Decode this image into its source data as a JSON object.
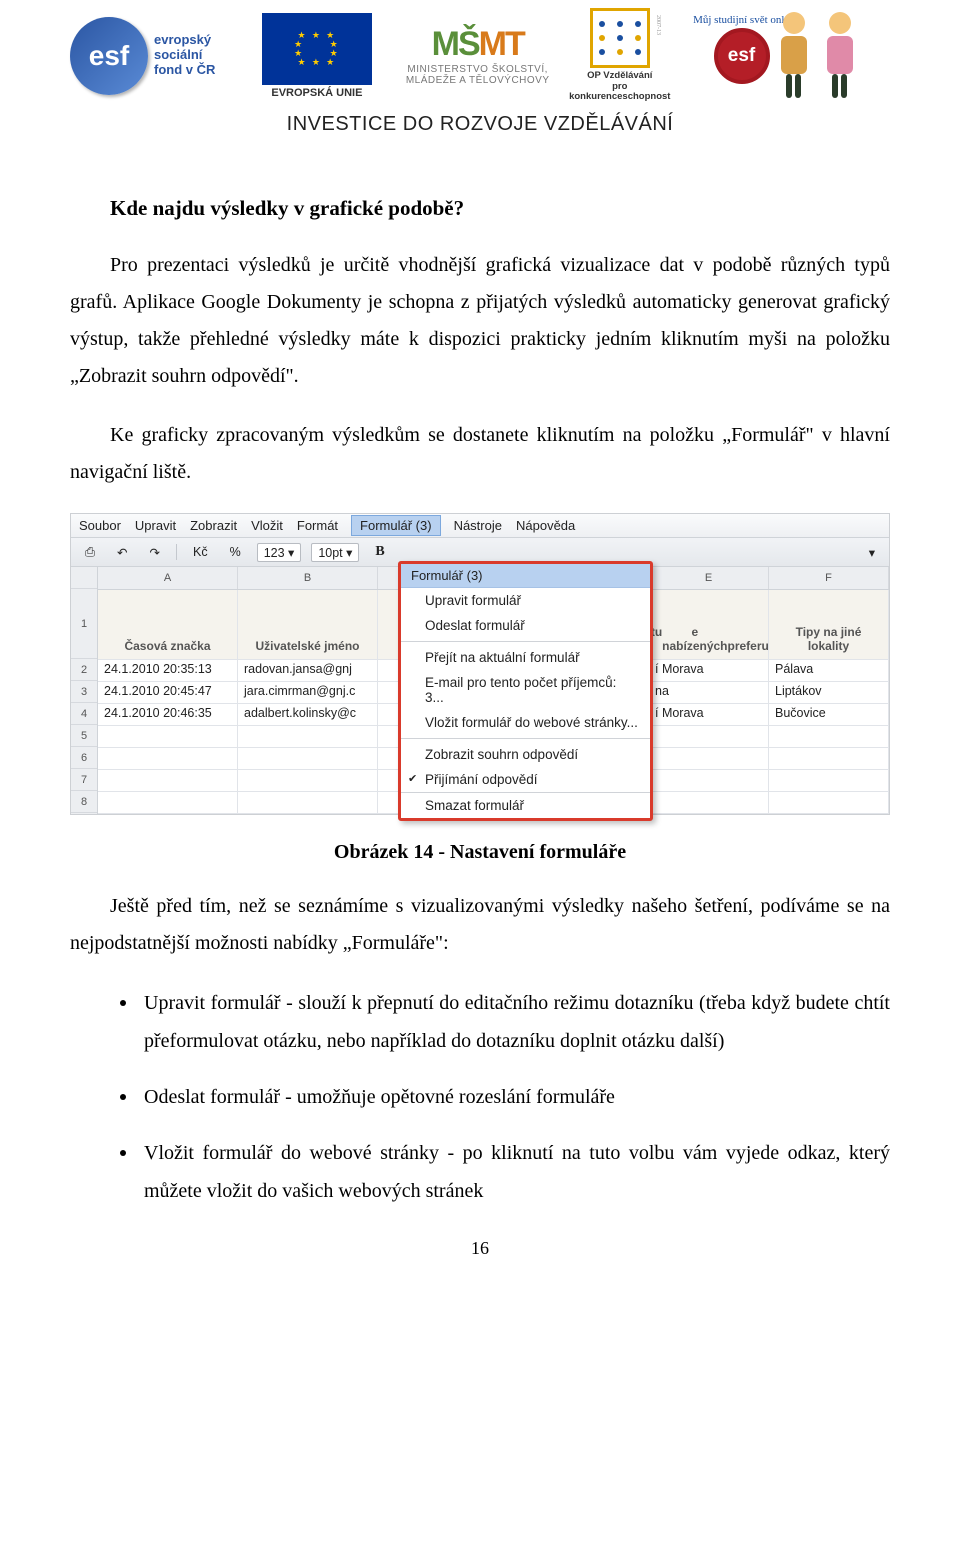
{
  "header": {
    "esf_abbr": "esf",
    "esf_text": "evropský\nsociální\nfond v ČR",
    "eu_caption": "EVROPSKÁ UNIE",
    "msmt_mark_m": "M",
    "msmt_mark_s": "Š",
    "msmt_mark_mt": "MT",
    "msmt_line1": "MINISTERSTVO ŠKOLSTVÍ,",
    "msmt_line2": "MLÁDEŽE A TĚLOVÝCHOVY",
    "op_line1": "OP Vzdělávání",
    "op_line2": "pro konkurenceschopnost",
    "last_badge": "esf",
    "last_text": "Můj studijní svět online",
    "invest": "INVESTICE DO ROZVOJE VZDĚLÁVÁNÍ"
  },
  "doc": {
    "heading": "Kde najdu výsledky v grafické podobě?",
    "p1": "Pro prezentaci výsledků je určitě vhodnější grafická vizualizace dat v podobě různých typů grafů. Aplikace Google Dokumenty je schopna z přijatých výsledků automaticky generovat grafický výstup, takže přehledné výsledky máte k dispozici prakticky jedním kliknutím myši na položku „Zobrazit souhrn odpovědí\".",
    "p2": "Ke graficky zpracovaným výsledkům se dostanete kliknutím na položku „Formulář\" v hlavní navigační liště.",
    "caption": "Obrázek 14 - Nastavení formuláře",
    "p3": "Ještě před tím, než se seznámíme s vizualizovanými výsledky našeho šetření, podíváme se na nejpodstatnější možnosti nabídky „Formuláře\":",
    "bullets": [
      "Upravit formulář - slouží k přepnutí do editačního režimu dotazníku (třeba když budete chtít přeformulovat otázku, nebo například do dotazníku doplnit otázku další)",
      "Odeslat formulář - umožňuje opětovné rozeslání formuláře",
      "Vložit formulář do webové stránky - po kliknutí na tuto volbu vám vyjede odkaz, který můžete vložit do vašich webových stránek"
    ],
    "page_number": "16"
  },
  "screenshot": {
    "menu": [
      "Soubor",
      "Upravit",
      "Zobrazit",
      "Vložit",
      "Formát",
      "Formulář (3)",
      "Nástroje",
      "Nápověda"
    ],
    "toolbar": {
      "kc": "Kč",
      "pct": "%",
      "num": "123",
      "font": "10pt",
      "bold": "B"
    },
    "columns": {
      "A": "A",
      "B": "B",
      "E": "E",
      "F": "F"
    },
    "headers": {
      "a": "Časová značka",
      "b": "Uživatelské jméno",
      "e": "kou lokalitu z e nabízených preferujete?",
      "e_frag1": "kou lokalitu z",
      "e_frag2": "e nabízených",
      "e_frag3": "preferujete?",
      "f": "Tipy na jiné lokality"
    },
    "rows": [
      {
        "n": "2",
        "a": "24.1.2010 20:35:13",
        "b": "radovan.jansa@gnj",
        "e": "í Morava",
        "f": "Pálava"
      },
      {
        "n": "3",
        "a": "24.1.2010 20:45:47",
        "b": "jara.cimrman@gnj.c",
        "e": "na",
        "f": "Liptákov"
      },
      {
        "n": "4",
        "a": "24.1.2010 20:46:35",
        "b": "adalbert.kolinsky@c",
        "e": "í Morava",
        "f": "Bučovice"
      }
    ],
    "empty_rows": [
      "5",
      "6",
      "7",
      "8"
    ],
    "dropdown": {
      "head": "Formulář (3)",
      "items": [
        {
          "label": "Upravit formulář"
        },
        {
          "label": "Odeslat formulář"
        },
        {
          "label": "Přejít na aktuální formulář",
          "sep_before": true
        },
        {
          "label": "E-mail pro tento počet příjemců: 3..."
        },
        {
          "label": "Vložit formulář do webové stránky..."
        },
        {
          "label": "Zobrazit souhrn odpovědí",
          "sep_before": true
        },
        {
          "label": "Přijímání odpovědí",
          "checked": true
        },
        {
          "label": "Smazat formulář",
          "foot": true
        }
      ]
    }
  }
}
